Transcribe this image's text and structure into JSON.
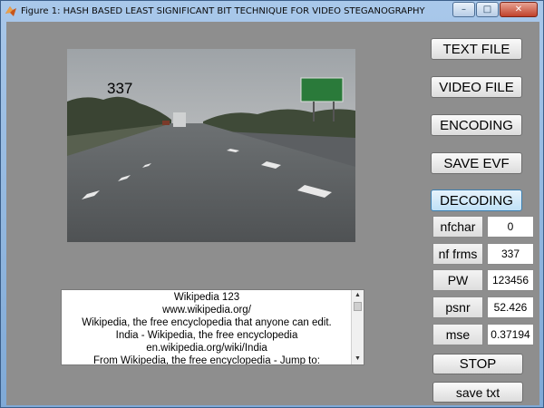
{
  "window": {
    "title": "Figure 1: HASH BASED LEAST SIGNIFICANT BIT TECHNIQUE FOR VIDEO STEGANOGRAPHY",
    "controls": {
      "minimize": "–",
      "maximize": "□",
      "close": "✕"
    }
  },
  "video": {
    "frame_number": "337"
  },
  "buttons": {
    "text_file": "TEXT FILE",
    "video_file": "VIDEO FILE",
    "encoding": "ENCODING",
    "save_evf": "SAVE EVF",
    "decoding": "DECODING",
    "stop": "STOP",
    "save_txt": "save txt"
  },
  "fields": {
    "nfchar": {
      "label": "nfchar",
      "value": "0"
    },
    "nf_frms": {
      "label": "nf frms",
      "value": "337"
    },
    "pw": {
      "label": "PW",
      "value": "123456"
    },
    "psnr": {
      "label": "psnr",
      "value": "52.426"
    },
    "mse": {
      "label": "mse",
      "value": "0.37194"
    }
  },
  "textbox": {
    "lines": [
      "Wikipedia 123",
      "www.wikipedia.org/",
      "Wikipedia, the free encyclopedia that anyone can edit.",
      "India - Wikipedia, the free encyclopedia",
      "en.wikipedia.org/wiki/India",
      "From Wikipedia, the free encyclopedia - Jump to:"
    ]
  },
  "colors": {
    "accent_button": "#bfe0f6",
    "client_bg": "#8e8e8e",
    "titlebar": "#a9c8ea"
  }
}
